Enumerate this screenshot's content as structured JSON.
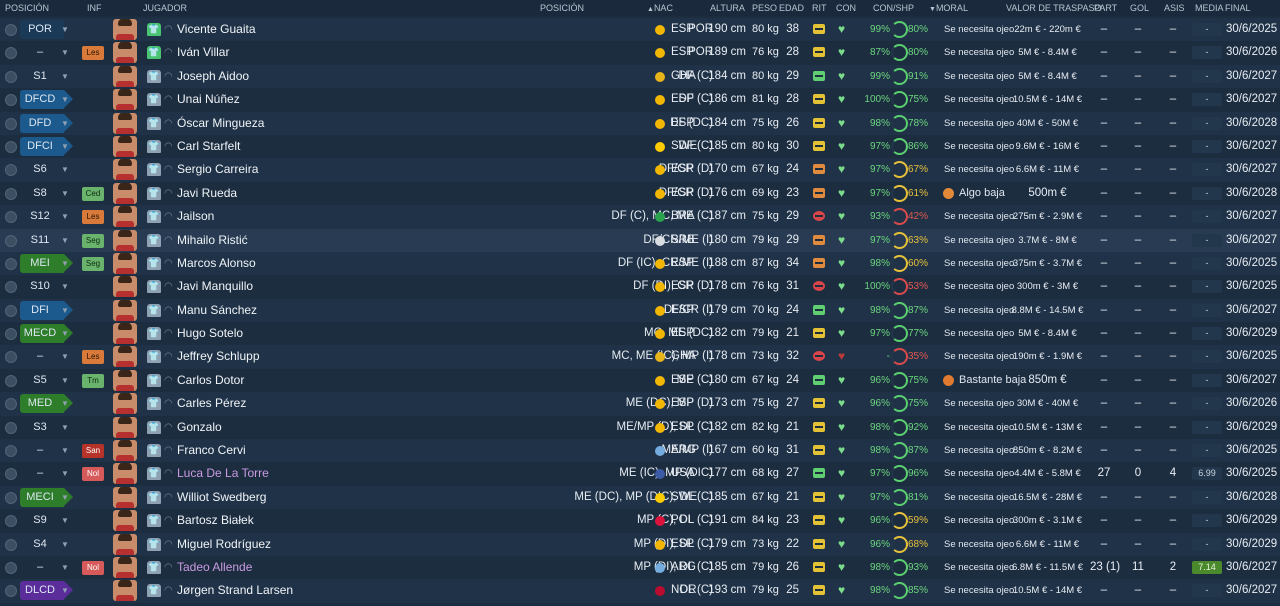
{
  "header": {
    "posicion": "POSICIÓN",
    "inf": "INF",
    "jugador": "JUGADOR",
    "posicion2": "POSICIÓN",
    "nac": "NAC",
    "altura": "ALTURA",
    "peso": "PESO",
    "edad": "EDAD",
    "rit": "RIT",
    "con": "CON",
    "conshp": "CON/SHP",
    "moral": "MORAL",
    "valor": "VALOR DE TRASPASO",
    "part": "PART",
    "gol": "GOL",
    "asis": "ASIS",
    "media": "MEDIA",
    "final": "FINAL"
  },
  "players": [
    {
      "pos": "POR",
      "posc": "n",
      "inf": "",
      "name": "Vicente Guaita",
      "gk": true,
      "role": "POR",
      "flag": "#f2b705",
      "nat": "ESP",
      "h": "190 cm",
      "w": "80 kg",
      "age": "38",
      "rit": "y",
      "con": "g",
      "cond": "99%",
      "shp": "80%",
      "shpc": "g",
      "moral": "Se necesita ojeo",
      "val": "22m € - 220m €",
      "part": "–",
      "gol": "–",
      "asis": "–",
      "med": "-",
      "fin": "30/6/2025"
    },
    {
      "pos": "–",
      "posc": "",
      "inf": "Les",
      "name": "Iván Villar",
      "gk": true,
      "role": "POR",
      "flag": "#f2b705",
      "nat": "ESP",
      "h": "189 cm",
      "w": "76 kg",
      "age": "28",
      "rit": "y",
      "con": "g",
      "cond": "87%",
      "shp": "80%",
      "shpc": "g",
      "moral": "Se necesita ojeo",
      "val": "5M € - 8.4M €",
      "part": "–",
      "gol": "–",
      "asis": "–",
      "med": "-",
      "fin": "30/6/2026"
    },
    {
      "pos": "S1",
      "posc": "",
      "inf": "",
      "name": "Joseph Aidoo",
      "gk": false,
      "role": "DF (C)",
      "flag": "#e8b41c",
      "nat": "GHA",
      "h": "184 cm",
      "w": "80 kg",
      "age": "29",
      "rit": "g",
      "con": "g",
      "cond": "99%",
      "shp": "91%",
      "shpc": "g",
      "moral": "Se necesita ojeo",
      "val": "5M € - 8.4M €",
      "part": "–",
      "gol": "–",
      "asis": "–",
      "med": "-",
      "fin": "30/6/2027"
    },
    {
      "pos": "DFCD",
      "posc": "b",
      "inf": "",
      "name": "Unai Núñez",
      "gk": false,
      "role": "DF (C)",
      "flag": "#f2b705",
      "nat": "ESP",
      "h": "186 cm",
      "w": "81 kg",
      "age": "28",
      "rit": "y",
      "con": "g",
      "cond": "100%",
      "shp": "75%",
      "shpc": "g",
      "moral": "Se necesita ojeo",
      "val": "10.5M € - 14M €",
      "part": "–",
      "gol": "–",
      "asis": "–",
      "med": "-",
      "fin": "30/6/2027"
    },
    {
      "pos": "DFD",
      "posc": "b",
      "inf": "",
      "name": "Óscar Mingueza",
      "gk": false,
      "role": "DF (DC)",
      "flag": "#f2b705",
      "nat": "ESP",
      "h": "184 cm",
      "w": "75 kg",
      "age": "26",
      "rit": "y",
      "con": "g",
      "cond": "98%",
      "shp": "78%",
      "shpc": "g",
      "moral": "Se necesita ojeo",
      "val": "40M € - 50M €",
      "part": "–",
      "gol": "–",
      "asis": "–",
      "med": "-",
      "fin": "30/6/2028"
    },
    {
      "pos": "DFCI",
      "posc": "b",
      "inf": "",
      "name": "Carl Starfelt",
      "gk": false,
      "role": "DF (C)",
      "flag": "#fecc02",
      "nat": "SWE",
      "h": "185 cm",
      "w": "80 kg",
      "age": "30",
      "rit": "y",
      "con": "g",
      "cond": "97%",
      "shp": "86%",
      "shpc": "g",
      "moral": "Se necesita ojeo",
      "val": "9.6M € - 16M €",
      "part": "–",
      "gol": "–",
      "asis": "–",
      "med": "-",
      "fin": "30/6/2027"
    },
    {
      "pos": "S6",
      "posc": "",
      "inf": "",
      "name": "Sergio Carreira",
      "gk": false,
      "role": "DF/CR (D)",
      "flag": "#f2b705",
      "nat": "ESP",
      "h": "170 cm",
      "w": "67 kg",
      "age": "24",
      "rit": "o",
      "con": "g",
      "cond": "97%",
      "shp": "67%",
      "shpc": "y",
      "moral": "Se necesita ojeo",
      "val": "6.6M € - 11M €",
      "part": "–",
      "gol": "–",
      "asis": "–",
      "med": "-",
      "fin": "30/6/2027"
    },
    {
      "pos": "S8",
      "posc": "",
      "inf": "Ced",
      "name": "Javi Rueda",
      "gk": false,
      "role": "DF/CR (D)",
      "flag": "#f2b705",
      "nat": "ESP",
      "h": "176 cm",
      "w": "69 kg",
      "age": "23",
      "rit": "o",
      "con": "g",
      "cond": "97%",
      "shp": "61%",
      "shpc": "y",
      "moral": "Algo baja",
      "moralIco": true,
      "val": "500m €",
      "valBig": true,
      "part": "–",
      "gol": "–",
      "asis": "–",
      "med": "-",
      "fin": "30/6/2028"
    },
    {
      "pos": "S12",
      "posc": "",
      "inf": "Les",
      "name": "Jailson",
      "gk": false,
      "role": "DF (C), MC, ME (C)",
      "flag": "#2ba24c",
      "nat": "BRA",
      "h": "187 cm",
      "w": "75 kg",
      "age": "29",
      "rit": "r",
      "con": "g",
      "cond": "93%",
      "shp": "42%",
      "shpc": "r",
      "moral": "Se necesita ojeo",
      "val": "275m € - 2.9M €",
      "part": "–",
      "gol": "–",
      "asis": "–",
      "med": "-",
      "fin": "30/6/2027"
    },
    {
      "pos": "S11",
      "posc": "",
      "inf": "Seg",
      "name": "Mihailo Ristić",
      "gk": false,
      "role": "DF/CR/ME (I)",
      "flag": "#d9dde2",
      "nat": "SRB",
      "h": "180 cm",
      "w": "79 kg",
      "age": "29",
      "rit": "o",
      "con": "g",
      "cond": "97%",
      "shp": "63%",
      "shpc": "y",
      "moral": "Se necesita ojeo",
      "val": "3.7M € - 8M €",
      "part": "–",
      "gol": "–",
      "asis": "–",
      "med": "-",
      "fin": "30/6/2027",
      "sel": true
    },
    {
      "pos": "MEI",
      "posc": "g",
      "inf": "Seg",
      "name": "Marcos Alonso",
      "gk": false,
      "role": "DF (IC), CR/ME (I)",
      "flag": "#f2b705",
      "nat": "ESP",
      "h": "188 cm",
      "w": "87 kg",
      "age": "34",
      "rit": "o",
      "con": "g",
      "cond": "98%",
      "shp": "60%",
      "shpc": "y",
      "moral": "Se necesita ojeo",
      "val": "375m € - 3.7M €",
      "part": "–",
      "gol": "–",
      "asis": "–",
      "med": "-",
      "fin": "30/6/2025"
    },
    {
      "pos": "S10",
      "posc": "",
      "inf": "",
      "name": "Javi Manquillo",
      "gk": false,
      "role": "DF (DI), CR (D)",
      "flag": "#f2b705",
      "nat": "ESP",
      "h": "178 cm",
      "w": "76 kg",
      "age": "31",
      "rit": "r",
      "con": "g",
      "cond": "100%",
      "shp": "53%",
      "shpc": "r",
      "moral": "Se necesita ojeo",
      "val": "300m € - 3M €",
      "part": "–",
      "gol": "–",
      "asis": "–",
      "med": "-",
      "fin": "30/6/2025"
    },
    {
      "pos": "DFI",
      "posc": "b",
      "inf": "",
      "name": "Manu Sánchez",
      "gk": false,
      "role": "DF/CR (I)",
      "flag": "#f2b705",
      "nat": "ESP",
      "h": "179 cm",
      "w": "70 kg",
      "age": "24",
      "rit": "g",
      "con": "g",
      "cond": "98%",
      "shp": "87%",
      "shpc": "g",
      "moral": "Se necesita ojeo",
      "val": "8.8M € - 14.5M €",
      "part": "–",
      "gol": "–",
      "asis": "–",
      "med": "-",
      "fin": "30/6/2027"
    },
    {
      "pos": "MECD",
      "posc": "g",
      "inf": "",
      "name": "Hugo Sotelo",
      "gk": false,
      "role": "MC, ME (DC)",
      "flag": "#f2b705",
      "nat": "ESP",
      "h": "182 cm",
      "w": "79 kg",
      "age": "21",
      "rit": "y",
      "con": "g",
      "cond": "97%",
      "shp": "77%",
      "shpc": "g",
      "moral": "Se necesita ojeo",
      "val": "5M € - 8.4M €",
      "part": "–",
      "gol": "–",
      "asis": "–",
      "med": "-",
      "fin": "30/6/2029"
    },
    {
      "pos": "–",
      "posc": "",
      "inf": "Les",
      "name": "Jeffrey Schlupp",
      "gk": false,
      "role": "MC, ME (IC), MP (I)",
      "flag": "#e8b41c",
      "nat": "GHA",
      "h": "178 cm",
      "w": "73 kg",
      "age": "32",
      "rit": "r",
      "con": "r",
      "cond": "-",
      "shp": "35%",
      "shpc": "r",
      "moral": "Se necesita ojeo",
      "val": "190m € - 1.9M €",
      "part": "–",
      "gol": "–",
      "asis": "–",
      "med": "-",
      "fin": "30/6/2025"
    },
    {
      "pos": "S5",
      "posc": "",
      "inf": "Tm",
      "name": "Carlos Dotor",
      "gk": false,
      "role": "ME (C)",
      "flag": "#f2b705",
      "nat": "ESP",
      "h": "180 cm",
      "w": "67 kg",
      "age": "24",
      "rit": "g",
      "con": "g",
      "cond": "96%",
      "shp": "75%",
      "shpc": "g",
      "moral": "Bastante baja",
      "moralIco": true,
      "val": "850m €",
      "valBig": true,
      "part": "–",
      "gol": "–",
      "asis": "–",
      "med": "-",
      "fin": "30/6/2027"
    },
    {
      "pos": "MED",
      "posc": "g",
      "inf": "",
      "name": "Carles Pérez",
      "gk": false,
      "role": "ME (DC), MP (D)",
      "flag": "#f2b705",
      "nat": "ESP",
      "h": "173 cm",
      "w": "75 kg",
      "age": "27",
      "rit": "y",
      "con": "g",
      "cond": "96%",
      "shp": "75%",
      "shpc": "g",
      "moral": "Se necesita ojeo",
      "val": "30M € - 40M €",
      "part": "–",
      "gol": "–",
      "asis": "–",
      "med": "-",
      "fin": "30/6/2026"
    },
    {
      "pos": "S3",
      "posc": "",
      "inf": "",
      "name": "Gonzalo",
      "gk": false,
      "role": "ME/MP (D), DL (C)",
      "flag": "#f2b705",
      "nat": "ESP",
      "h": "182 cm",
      "w": "82 kg",
      "age": "21",
      "rit": "y",
      "con": "g",
      "cond": "98%",
      "shp": "92%",
      "shpc": "g",
      "moral": "Se necesita ojeo",
      "val": "10.5M € - 13M €",
      "part": "–",
      "gol": "–",
      "asis": "–",
      "med": "-",
      "fin": "30/6/2029"
    },
    {
      "pos": "–",
      "posc": "",
      "inf": "San",
      "name": "Franco Cervi",
      "gk": false,
      "role": "ME/MP (I)",
      "flag": "#74acdf",
      "nat": "ARG",
      "h": "167 cm",
      "w": "60 kg",
      "age": "31",
      "rit": "y",
      "con": "g",
      "cond": "98%",
      "shp": "87%",
      "shpc": "g",
      "moral": "Se necesita ojeo",
      "val": "850m € - 8.2M €",
      "part": "–",
      "gol": "–",
      "asis": "–",
      "med": "-",
      "fin": "30/6/2025"
    },
    {
      "pos": "–",
      "posc": "",
      "inf": "Nol",
      "name": "Luca De La Torre",
      "gk": false,
      "loan": true,
      "role": "ME (IC), MP (DIC)",
      "flag": "#3c5aa6",
      "nat": "USA",
      "h": "177 cm",
      "w": "68 kg",
      "age": "27",
      "rit": "g",
      "con": "g",
      "cond": "97%",
      "shp": "96%",
      "shpc": "g",
      "moral": "Se necesita ojeo",
      "val": "4.4M € - 5.8M €",
      "part": "27",
      "gol": "0",
      "asis": "4",
      "med": "6.99",
      "fin": "30/6/2025"
    },
    {
      "pos": "MECI",
      "posc": "g",
      "inf": "",
      "name": "Williot Swedberg",
      "gk": false,
      "role": "ME (DC), MP (DIC), DL (C)",
      "flag": "#fecc02",
      "nat": "SWE",
      "h": "185 cm",
      "w": "67 kg",
      "age": "21",
      "rit": "y",
      "con": "g",
      "cond": "97%",
      "shp": "81%",
      "shpc": "g",
      "moral": "Se necesita ojeo",
      "val": "16.5M € - 28M €",
      "part": "–",
      "gol": "–",
      "asis": "–",
      "med": "-",
      "fin": "30/6/2028"
    },
    {
      "pos": "S9",
      "posc": "",
      "inf": "",
      "name": "Bartosz Białek",
      "gk": false,
      "role": "MP (C), DL (C)",
      "flag": "#dc143c",
      "nat": "POL",
      "h": "191 cm",
      "w": "84 kg",
      "age": "23",
      "rit": "y",
      "con": "g",
      "cond": "96%",
      "shp": "59%",
      "shpc": "y",
      "moral": "Se necesita ojeo",
      "val": "300m € - 3.1M €",
      "part": "–",
      "gol": "–",
      "asis": "–",
      "med": "-",
      "fin": "30/6/2029"
    },
    {
      "pos": "S4",
      "posc": "",
      "inf": "",
      "name": "Miguel Rodríguez",
      "gk": false,
      "role": "MP (DI), DL (C)",
      "flag": "#f2b705",
      "nat": "ESP",
      "h": "179 cm",
      "w": "73 kg",
      "age": "22",
      "rit": "y",
      "con": "g",
      "cond": "96%",
      "shp": "68%",
      "shpc": "y",
      "moral": "Se necesita ojeo",
      "val": "6.6M € - 11M €",
      "part": "–",
      "gol": "–",
      "asis": "–",
      "med": "-",
      "fin": "30/6/2029"
    },
    {
      "pos": "–",
      "posc": "",
      "inf": "Nol",
      "name": "Tadeo Allende",
      "gk": false,
      "loan": true,
      "role": "MP (DI), DL (C)",
      "flag": "#74acdf",
      "nat": "ARG",
      "h": "185 cm",
      "w": "79 kg",
      "age": "26",
      "rit": "y",
      "con": "g",
      "cond": "98%",
      "shp": "93%",
      "shpc": "g",
      "moral": "Se necesita ojeo",
      "val": "6.8M € - 11.5M €",
      "part": "23 (1)",
      "gol": "11",
      "asis": "2",
      "med": "7.14",
      "medGreen": true,
      "fin": "30/6/2027"
    },
    {
      "pos": "DLCD",
      "posc": "p",
      "inf": "",
      "name": "Jørgen Strand Larsen",
      "gk": false,
      "role": "DL (C)",
      "flag": "#ba0c2f",
      "nat": "NOR",
      "h": "193 cm",
      "w": "79 kg",
      "age": "25",
      "rit": "y",
      "con": "g",
      "cond": "98%",
      "shp": "85%",
      "shpc": "g",
      "moral": "Se necesita ojeo",
      "val": "10.5M € - 14M €",
      "part": "–",
      "gol": "–",
      "asis": "–",
      "med": "-",
      "fin": "30/6/2027"
    }
  ]
}
